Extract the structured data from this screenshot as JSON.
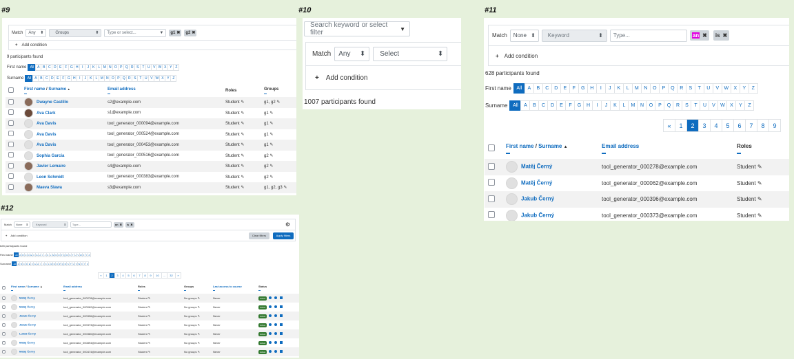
{
  "labels": {
    "p9": "#9",
    "p10": "#10",
    "p11": "#11",
    "p12": "#12"
  },
  "icons": {
    "pencil": "✎",
    "times": "✖",
    "plus": "+",
    "updown": "⬍",
    "caret": "▼",
    "gear": "⚙",
    "sort_up": "▲"
  },
  "colors": {
    "accent": "#0f6cbf",
    "highlight": "#e100e1",
    "background": "#e6f1dc",
    "active_badge": "#357a32"
  },
  "letters": [
    "All",
    "A",
    "B",
    "C",
    "D",
    "E",
    "F",
    "G",
    "H",
    "I",
    "J",
    "K",
    "L",
    "M",
    "N",
    "O",
    "P",
    "Q",
    "R",
    "S",
    "T",
    "U",
    "V",
    "W",
    "X",
    "Y",
    "Z"
  ],
  "p9": {
    "match_label": "Match",
    "match_value": "Any",
    "field_value": "Groups",
    "type_placeholder": "Type or select...",
    "tags": [
      "g1",
      "g2"
    ],
    "add_condition": "Add condition",
    "count": "9 participants found",
    "firstname_label": "First name",
    "surname_label": "Surname",
    "headers": {
      "name_a": "First name",
      "sep": " / ",
      "name_b": "Surname",
      "email": "Email address",
      "roles": "Roles",
      "groups": "Groups"
    },
    "rows": [
      {
        "name": "Dwayne Castillo",
        "email": "s2@example.com",
        "role": "Student",
        "groups": "g1, g2",
        "avatar": "photo"
      },
      {
        "name": "Ava Clark",
        "email": "s1@example.com",
        "role": "Student",
        "groups": "g1",
        "avatar": "dark"
      },
      {
        "name": "Ava Davis",
        "email": "tool_generator_000094@example.com",
        "role": "Student",
        "groups": "g1",
        "avatar": "none"
      },
      {
        "name": "Ava Davis",
        "email": "tool_generator_000524@example.com",
        "role": "Student",
        "groups": "g1",
        "avatar": "none"
      },
      {
        "name": "Ava Davis",
        "email": "tool_generator_000453@example.com",
        "role": "Student",
        "groups": "g1",
        "avatar": "none"
      },
      {
        "name": "Sophia Garcia",
        "email": "tool_generator_000516@example.com",
        "role": "Student",
        "groups": "g2",
        "avatar": "none"
      },
      {
        "name": "Javier Lemaire",
        "email": "s4@example.com",
        "role": "Student",
        "groups": "g2",
        "avatar": "photo"
      },
      {
        "name": "Leon Schmidt",
        "email": "tool_generator_000383@example.com",
        "role": "Student",
        "groups": "g2",
        "avatar": "none"
      },
      {
        "name": "Maeva Slawa",
        "email": "s3@example.com",
        "role": "Student",
        "groups": "g1, g2, g3",
        "avatar": "photo"
      }
    ]
  },
  "p10": {
    "search_placeholder": "Search keyword or select filter",
    "match_label": "Match",
    "match_value": "Any",
    "select_value": "Select",
    "add_condition": "Add condition",
    "count": "1007 participants found"
  },
  "p11": {
    "match_label": "Match",
    "match_value": "None",
    "field_value": "Keyword",
    "type_placeholder": "Type...",
    "tag_a": "an",
    "tag_b": "is",
    "add_condition": "Add condition",
    "count": "628 participants found",
    "firstname_label": "First name",
    "surname_label": "Surname",
    "pages": [
      "«",
      "1",
      "2",
      "3",
      "4",
      "5",
      "6",
      "7",
      "8",
      "9"
    ],
    "active_page": "2",
    "headers": {
      "name_a": "First name",
      "sep": " / ",
      "name_b": "Surname",
      "email": "Email address",
      "roles": "Roles"
    },
    "rows": [
      {
        "name": "Matěj Černý",
        "email": "tool_generator_000278@example.com",
        "role": "Student"
      },
      {
        "name": "Matěj Černý",
        "email": "tool_generator_000062@example.com",
        "role": "Student"
      },
      {
        "name": "Jakub Černý",
        "email": "tool_generator_000396@example.com",
        "role": "Student"
      },
      {
        "name": "Jakub Černý",
        "email": "tool_generator_000373@example.com",
        "role": "Student"
      }
    ]
  },
  "p12": {
    "match_label": "Match",
    "match_value": "None",
    "field_value": "Keyword",
    "type_placeholder": "Type...",
    "tag_a": "an",
    "tag_b": "is",
    "add_condition": "Add condition",
    "clear": "Clear filters",
    "apply": "Apply filters",
    "count": "628 participants found",
    "firstname_label": "First name",
    "surname_label": "Surname",
    "pages": [
      "«",
      "1",
      "2",
      "3",
      "4",
      "5",
      "6",
      "7",
      "8",
      "9",
      "10",
      "...",
      "32",
      "»"
    ],
    "active_page": "2",
    "headers": {
      "name_a": "First name",
      "sep": " / ",
      "name_b": "Surname",
      "email": "Email address",
      "roles": "Roles",
      "groups": "Groups",
      "access": "Last access to course",
      "status": "Status"
    },
    "rows": [
      {
        "name": "Matěj Černý",
        "email": "tool_generator_000278@example.com",
        "role": "Student",
        "groups": "No groups",
        "access": "Never",
        "status": "Active"
      },
      {
        "name": "Matěj Černý",
        "email": "tool_generator_000062@example.com",
        "role": "Student",
        "groups": "No groups",
        "access": "Never",
        "status": "Active"
      },
      {
        "name": "Jakub Černý",
        "email": "tool_generator_000396@example.com",
        "role": "Student",
        "groups": "No groups",
        "access": "Never",
        "status": "Active"
      },
      {
        "name": "Jakub Černý",
        "email": "tool_generator_000373@example.com",
        "role": "Student",
        "groups": "No groups",
        "access": "Never",
        "status": "Active"
      },
      {
        "name": "Lukáš Černý",
        "email": "tool_generator_000360@example.com",
        "role": "Student",
        "groups": "No groups",
        "access": "Never",
        "status": "Active"
      },
      {
        "name": "Matěj Černý",
        "email": "tool_generator_000894@example.com",
        "role": "Student",
        "groups": "No groups",
        "access": "Never",
        "status": "Active"
      },
      {
        "name": "Matěj Černý",
        "email": "tool_generator_000474@example.com",
        "role": "Student",
        "groups": "No groups",
        "access": "Never",
        "status": "Active"
      }
    ]
  }
}
